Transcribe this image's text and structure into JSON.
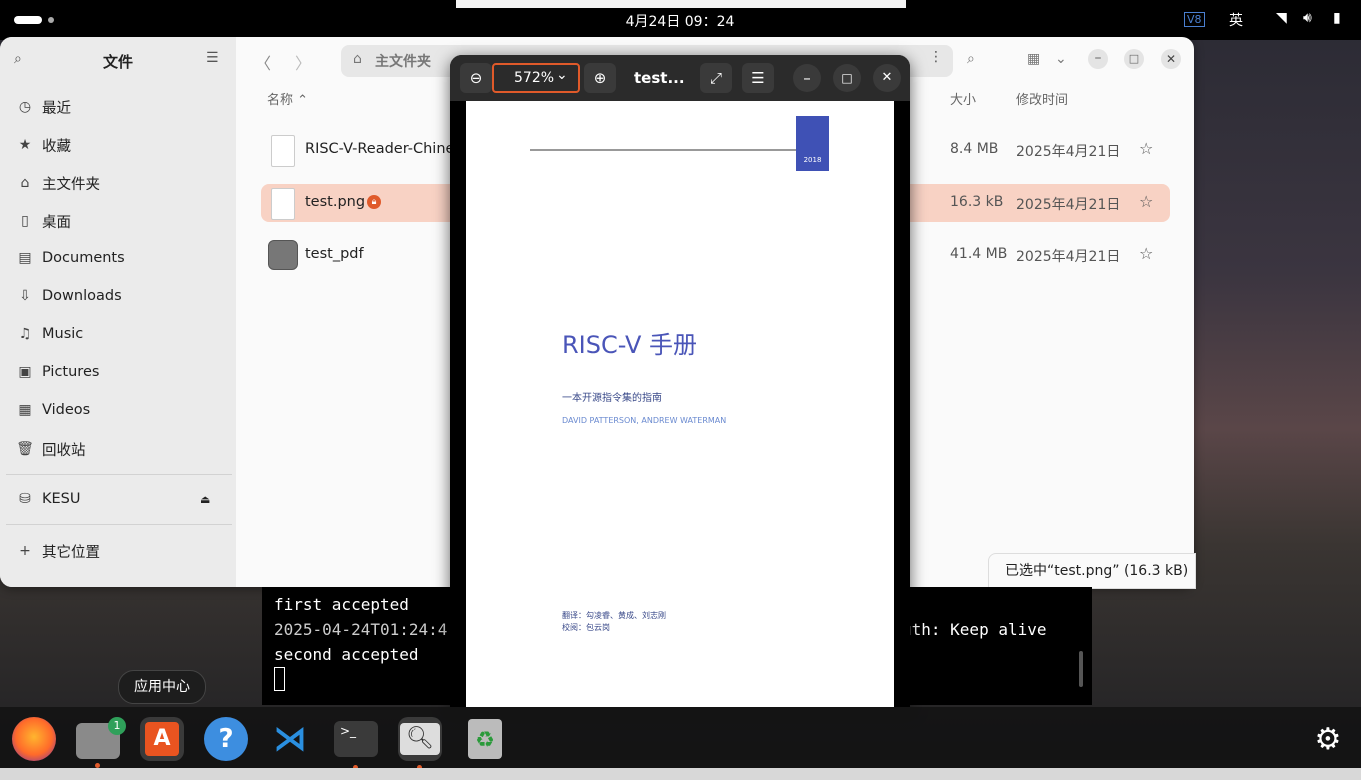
{
  "topbar": {
    "clock": "4月24日 09：24",
    "lang": "英",
    "vpn": "V8"
  },
  "files": {
    "title": "文件",
    "sidebar": [
      {
        "icon": "clock-icon",
        "label": "最近"
      },
      {
        "icon": "star-icon",
        "label": "收藏"
      },
      {
        "icon": "home-icon",
        "label": "主文件夹"
      },
      {
        "icon": "desktop-icon",
        "label": "桌面"
      },
      {
        "icon": "document-icon",
        "label": "Documents"
      },
      {
        "icon": "download-icon",
        "label": "Downloads"
      },
      {
        "icon": "music-icon",
        "label": "Music"
      },
      {
        "icon": "picture-icon",
        "label": "Pictures"
      },
      {
        "icon": "video-icon",
        "label": "Videos"
      },
      {
        "icon": "trash-icon",
        "label": "回收站"
      }
    ],
    "drive": "KESU",
    "other": "其它位置",
    "path": "主文件夹",
    "columns": {
      "name": "名称",
      "size": "大小",
      "modified": "修改时间"
    },
    "rows": [
      {
        "name": "RISC-V-Reader-Chinese",
        "size": "8.4 MB",
        "date": "2025年4月21日"
      },
      {
        "name": "test.png",
        "size": "16.3 kB",
        "date": "2025年4月21日"
      },
      {
        "name": "test_pdf",
        "size": "41.4 MB",
        "date": "2025年4月21日"
      }
    ],
    "status": "已选中“test.png” (16.3 kB)"
  },
  "terminal": {
    "lines": [
      "first accepted",
      "2025-04-24T01:24:4",
      "second accepted"
    ],
    "right": "uth: Keep alive"
  },
  "viewer": {
    "zoom": "572%",
    "title": "test...",
    "page": {
      "year": "2018",
      "title": "RISC-V 手册",
      "subtitle": "一本开源指令集的指南",
      "authors": "DAVID PATTERSON, ANDREW WATERMAN",
      "translators": "翻译：勾凌睿、黄成、刘志刚",
      "reviewer": "校阅：包云岗"
    }
  },
  "dock": {
    "tooltip": "应用中心",
    "files_badge": "1",
    "help": "?"
  }
}
